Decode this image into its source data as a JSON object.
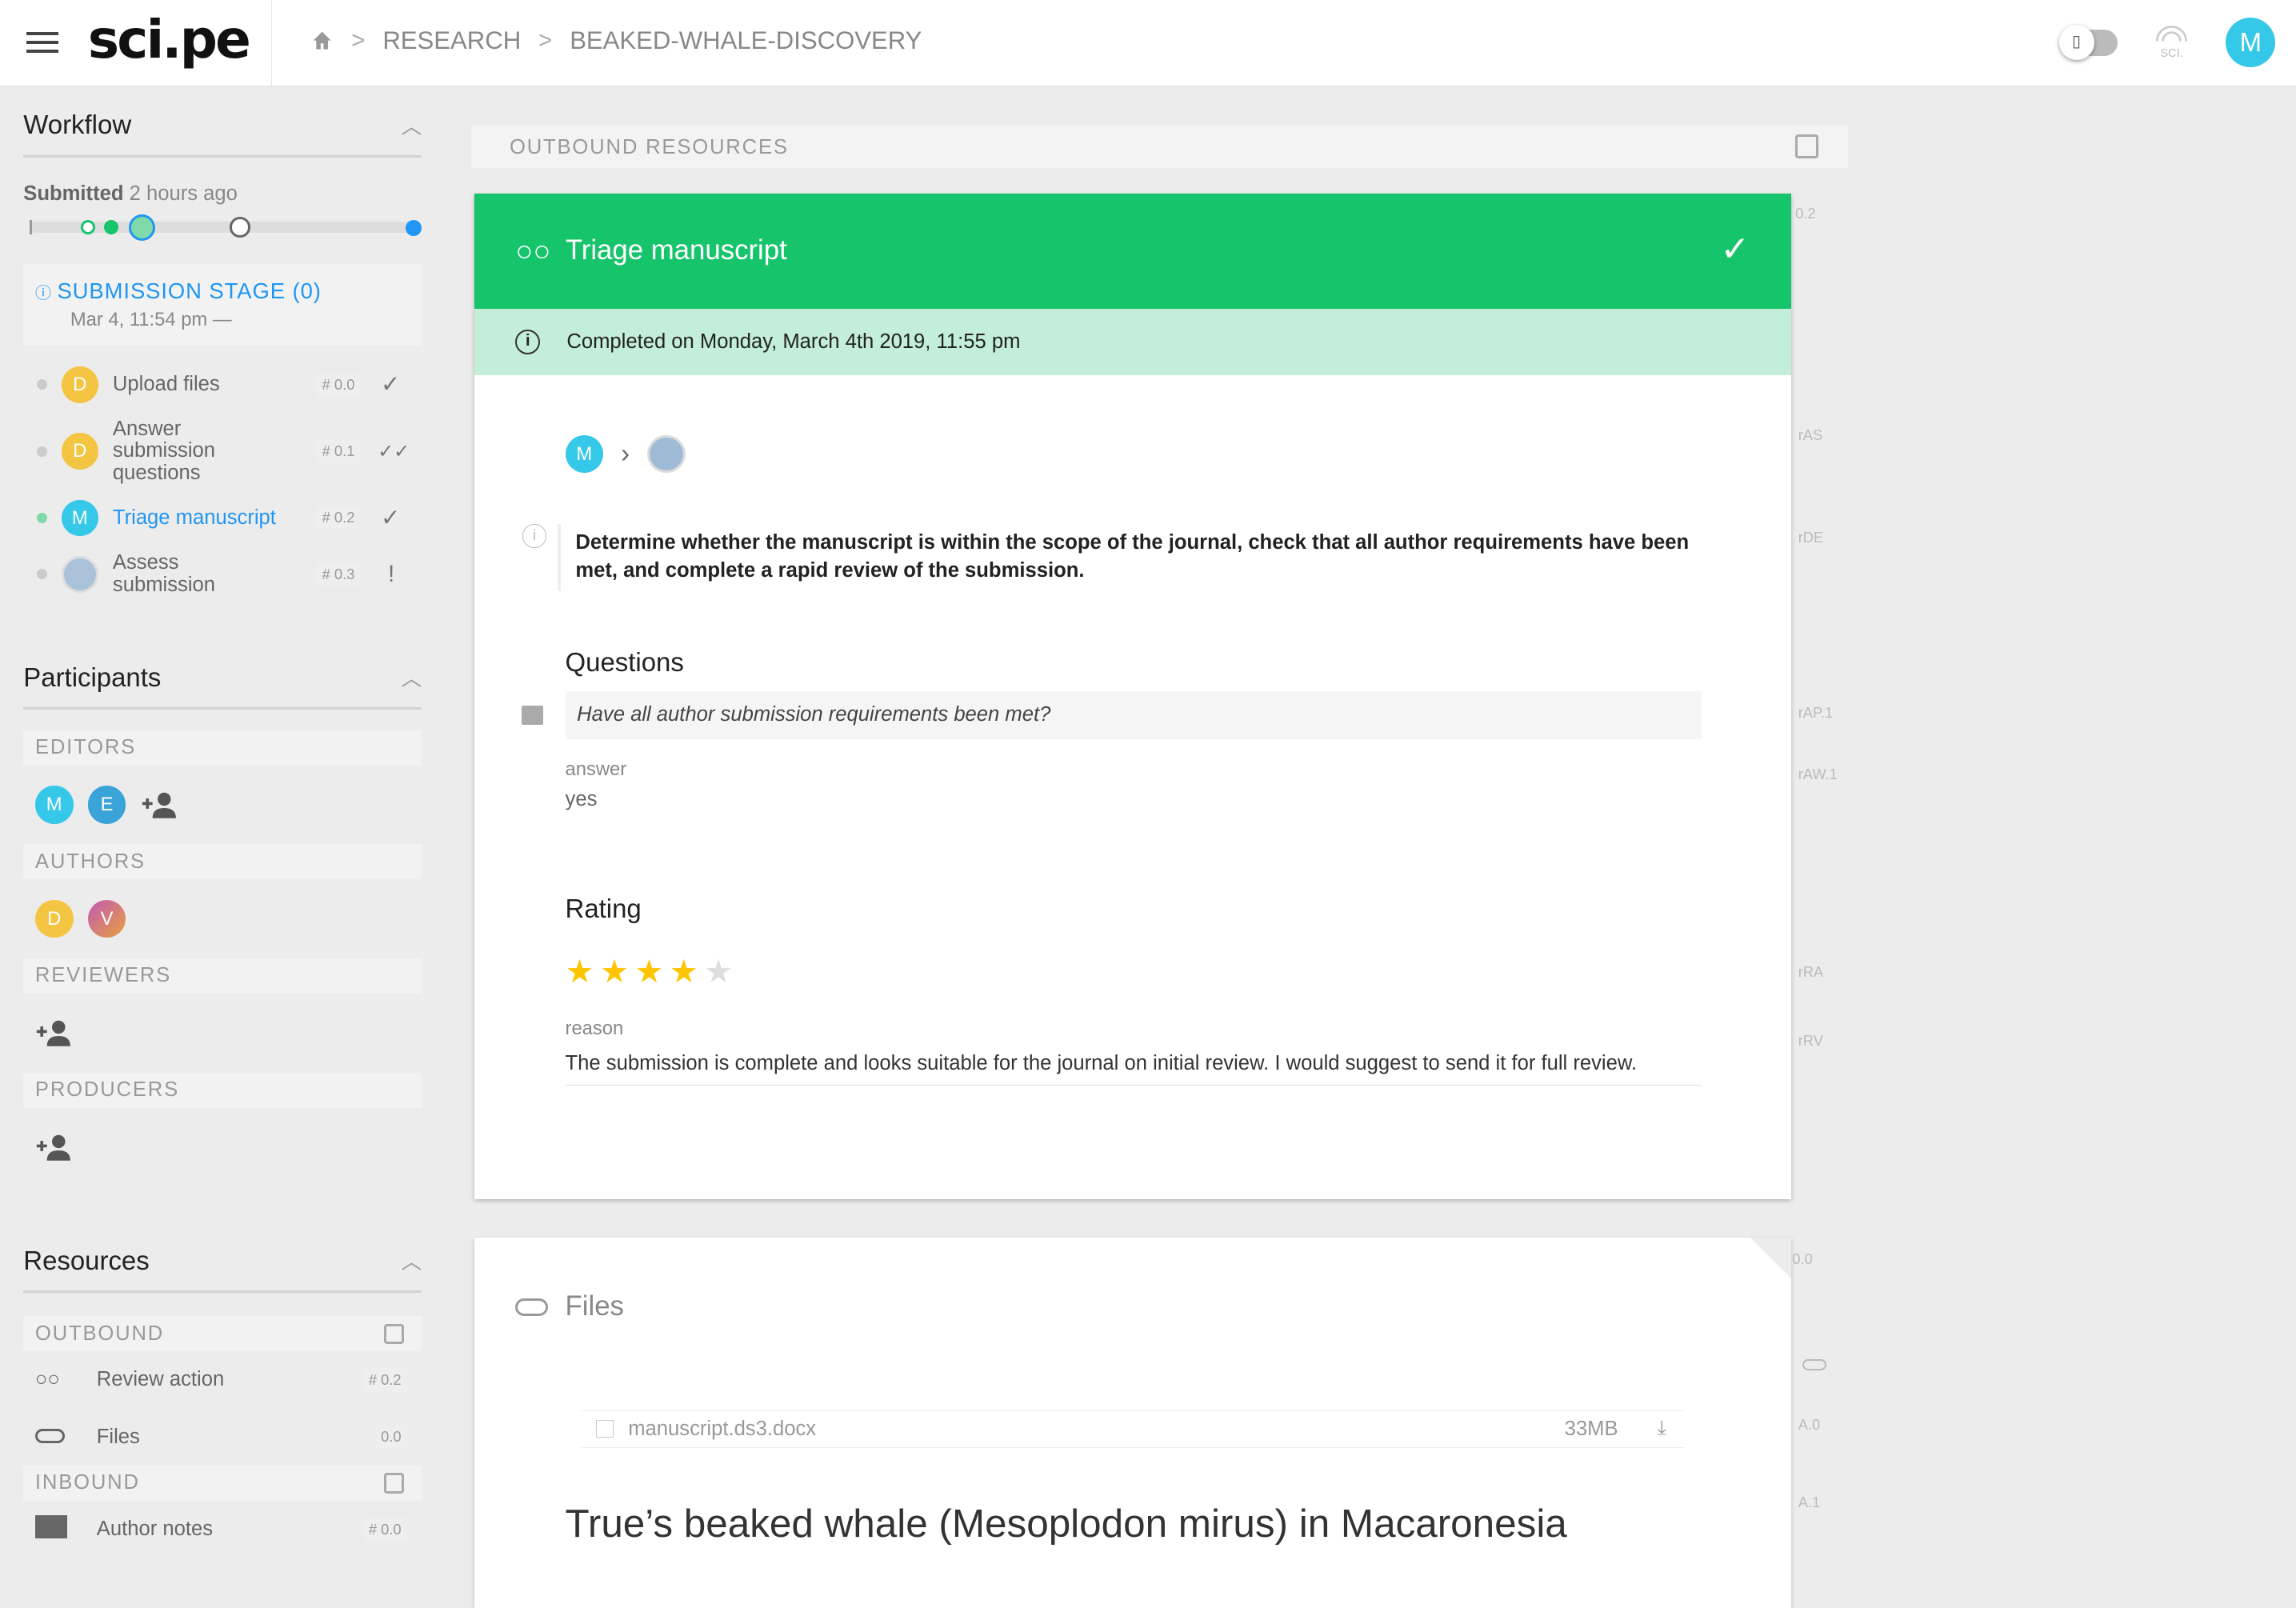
{
  "app": {
    "logo": "sci.pe"
  },
  "breadcrumb": {
    "items": [
      "RESEARCH",
      "BEAKED-WHALE-DISCOVERY"
    ]
  },
  "topbar": {
    "user_initial": "M",
    "sci_badge": "SCI."
  },
  "workflow": {
    "title": "Workflow",
    "submitted_label": "Submitted",
    "submitted_time": "2 hours ago",
    "stage": {
      "title": "SUBMISSION STAGE (0)",
      "subtitle": "Mar 4, 11:54 pm —"
    },
    "items": [
      {
        "avatar": "D",
        "label": "Upload files",
        "tag": "# 0.0",
        "status": "✓"
      },
      {
        "avatar": "D",
        "label": "Answer submission questions",
        "tag": "# 0.1",
        "status": "✓✓"
      },
      {
        "avatar": "M",
        "label": "Triage manuscript",
        "tag": "# 0.2",
        "status": "✓"
      },
      {
        "avatar": "",
        "label": "Assess submission",
        "tag": "# 0.3",
        "status": "!"
      }
    ]
  },
  "participants": {
    "title": "Participants",
    "groups": [
      {
        "name": "EDITORS",
        "members": [
          "M",
          "E"
        ]
      },
      {
        "name": "AUTHORS",
        "members": [
          "D",
          "V"
        ]
      },
      {
        "name": "REVIEWERS",
        "members": []
      },
      {
        "name": "PRODUCERS",
        "members": []
      }
    ]
  },
  "resources": {
    "title": "Resources",
    "outbound_label": "OUTBOUND",
    "outbound": [
      {
        "label": "Review action",
        "tag": "# 0.2"
      },
      {
        "label": "Files",
        "tag": "0.0"
      }
    ],
    "inbound_label": "INBOUND",
    "inbound": [
      {
        "label": "Author notes",
        "tag": "# 0.0"
      }
    ]
  },
  "main": {
    "outbound_header": "OUTBOUND RESOURCES",
    "card": {
      "title": "Triage manuscript",
      "completed": "Completed on Monday, March 4th 2019, 11:55 pm",
      "assignee": "M",
      "description": "Determine whether the manuscript is within the scope of the journal, check that all author requirements have been met, and complete a rapid review of the submission.",
      "questions_title": "Questions",
      "question": "Have all author submission requirements been met?",
      "answer_label": "answer",
      "answer": "yes",
      "rating_title": "Rating",
      "rating": 4,
      "rating_max": 5,
      "reason_label": "reason",
      "reason": "The submission is complete and looks suitable for the journal on initial review. I would suggest to send it for full review."
    },
    "files": {
      "title": "Files",
      "file_name": "manuscript.ds3.docx",
      "file_size": "33MB",
      "paper_title": "True’s beaked whale (Mesoplodon mirus) in Macaronesia"
    },
    "margin_tags": [
      "0.2",
      "rAS",
      "rDE",
      "rAP.1",
      "rAW.1",
      "rRA",
      "rRV",
      "0.0",
      "A.0",
      "A.1"
    ]
  },
  "colors": {
    "accent": "#16c46b",
    "complete_bg": "#c3eed7",
    "link": "#2196f3",
    "avatar_m": "#36c8e8",
    "avatar_d": "#f4c542",
    "star": "#ffc400"
  }
}
